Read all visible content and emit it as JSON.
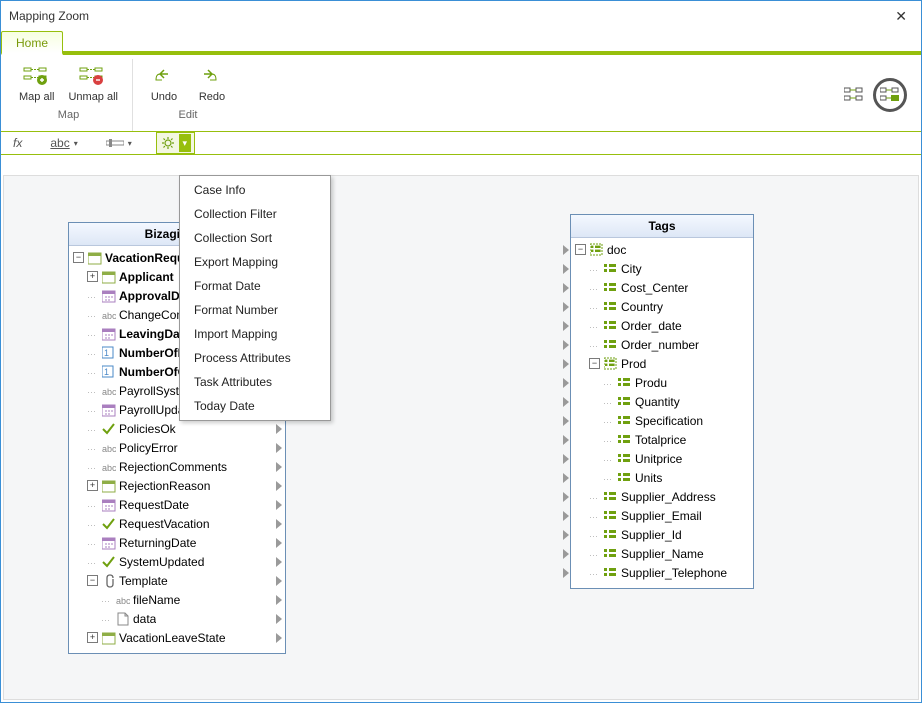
{
  "window": {
    "title": "Mapping Zoom"
  },
  "ribbon": {
    "tabs": [
      {
        "label": "Home"
      }
    ],
    "groups": {
      "map": {
        "name": "Map",
        "items": {
          "map_all": "Map all",
          "unmap_all": "Unmap all"
        }
      },
      "edit": {
        "name": "Edit",
        "items": {
          "undo": "Undo",
          "redo": "Redo"
        }
      }
    }
  },
  "formula_bar": {
    "fx": "fx",
    "abc": "abc"
  },
  "dropdown": {
    "items": [
      "Case Info",
      "Collection Filter",
      "Collection Sort",
      "Export Mapping",
      "Format Date",
      "Format Number",
      "Import Mapping",
      "Process Attributes",
      "Task Attributes",
      "Today Date"
    ]
  },
  "left_panel": {
    "title": "Bizagi Data",
    "nodes": [
      {
        "label": "VacationRequest",
        "indent": 0,
        "toggle": "-",
        "icon": "entity",
        "bold": true,
        "conn": false,
        "truncated": "VacationRequ"
      },
      {
        "label": "Applicant",
        "indent": 1,
        "toggle": "+",
        "icon": "entity",
        "bold": true,
        "conn": false
      },
      {
        "label": "ApprovalDate",
        "indent": 1,
        "icon": "date",
        "bold": true,
        "conn": true,
        "truncated": "ApprovalDate"
      },
      {
        "label": "ChangeComments",
        "indent": 1,
        "icon": "text",
        "bold": false,
        "conn": true,
        "truncated": "ChangeComm"
      },
      {
        "label": "LeavingDate",
        "indent": 1,
        "icon": "date",
        "bold": true,
        "conn": true
      },
      {
        "label": "NumberOfDays",
        "indent": 1,
        "icon": "num",
        "bold": true,
        "conn": true,
        "truncated": "NumberOfDa"
      },
      {
        "label": "NumberOfOfficeDays",
        "indent": 1,
        "icon": "num",
        "bold": true,
        "conn": true,
        "truncated": "NumberOfOff"
      },
      {
        "label": "PayrollSystemCode",
        "indent": 1,
        "icon": "text",
        "bold": false,
        "conn": true
      },
      {
        "label": "PayrollUpdateDate",
        "indent": 1,
        "icon": "date",
        "bold": false,
        "conn": true
      },
      {
        "label": "PoliciesOk",
        "indent": 1,
        "icon": "bool",
        "bold": false,
        "conn": true
      },
      {
        "label": "PolicyError",
        "indent": 1,
        "icon": "text",
        "bold": false,
        "conn": true
      },
      {
        "label": "RejectionComments",
        "indent": 1,
        "icon": "text",
        "bold": false,
        "conn": true
      },
      {
        "label": "RejectionReason",
        "indent": 1,
        "toggle": "+",
        "icon": "entity",
        "bold": false,
        "conn": true
      },
      {
        "label": "RequestDate",
        "indent": 1,
        "icon": "date",
        "bold": false,
        "conn": true
      },
      {
        "label": "RequestVacation",
        "indent": 1,
        "icon": "bool",
        "bold": false,
        "conn": true
      },
      {
        "label": "ReturningDate",
        "indent": 1,
        "icon": "date",
        "bold": false,
        "conn": true
      },
      {
        "label": "SystemUpdated",
        "indent": 1,
        "icon": "bool",
        "bold": false,
        "conn": true
      },
      {
        "label": "Template",
        "indent": 1,
        "toggle": "-",
        "icon": "attach",
        "bold": false,
        "conn": true
      },
      {
        "label": "fileName",
        "indent": 2,
        "icon": "text",
        "bold": false,
        "conn": true
      },
      {
        "label": "data",
        "indent": 2,
        "icon": "file",
        "bold": false,
        "conn": true
      },
      {
        "label": "VacationLeaveState",
        "indent": 1,
        "toggle": "+",
        "icon": "entity",
        "bold": false,
        "conn": true
      }
    ]
  },
  "right_panel": {
    "title": "Tags",
    "nodes": [
      {
        "label": "doc",
        "indent": 0,
        "toggle": "-",
        "icon": "tag-group",
        "bold": false,
        "conn": true
      },
      {
        "label": "City",
        "indent": 1,
        "icon": "tag",
        "bold": false,
        "conn": true
      },
      {
        "label": "Cost_Center",
        "indent": 1,
        "icon": "tag",
        "bold": false,
        "conn": true
      },
      {
        "label": "Country",
        "indent": 1,
        "icon": "tag",
        "bold": false,
        "conn": true
      },
      {
        "label": "Order_date",
        "indent": 1,
        "icon": "tag",
        "bold": false,
        "conn": true
      },
      {
        "label": "Order_number",
        "indent": 1,
        "icon": "tag",
        "bold": false,
        "conn": true
      },
      {
        "label": "Prod",
        "indent": 1,
        "toggle": "-",
        "icon": "tag-group",
        "bold": false,
        "conn": true
      },
      {
        "label": "Produ",
        "indent": 2,
        "icon": "tag",
        "bold": false,
        "conn": true
      },
      {
        "label": "Quantity",
        "indent": 2,
        "icon": "tag",
        "bold": false,
        "conn": true
      },
      {
        "label": "Specification",
        "indent": 2,
        "icon": "tag",
        "bold": false,
        "conn": true
      },
      {
        "label": "Totalprice",
        "indent": 2,
        "icon": "tag",
        "bold": false,
        "conn": true
      },
      {
        "label": "Unitprice",
        "indent": 2,
        "icon": "tag",
        "bold": false,
        "conn": true
      },
      {
        "label": "Units",
        "indent": 2,
        "icon": "tag",
        "bold": false,
        "conn": true
      },
      {
        "label": "Supplier_Address",
        "indent": 1,
        "icon": "tag",
        "bold": false,
        "conn": true
      },
      {
        "label": "Supplier_Email",
        "indent": 1,
        "icon": "tag",
        "bold": false,
        "conn": true
      },
      {
        "label": "Supplier_Id",
        "indent": 1,
        "icon": "tag",
        "bold": false,
        "conn": true
      },
      {
        "label": "Supplier_Name",
        "indent": 1,
        "icon": "tag",
        "bold": false,
        "conn": true
      },
      {
        "label": "Supplier_Telephone",
        "indent": 1,
        "icon": "tag",
        "bold": false,
        "conn": true
      }
    ]
  }
}
